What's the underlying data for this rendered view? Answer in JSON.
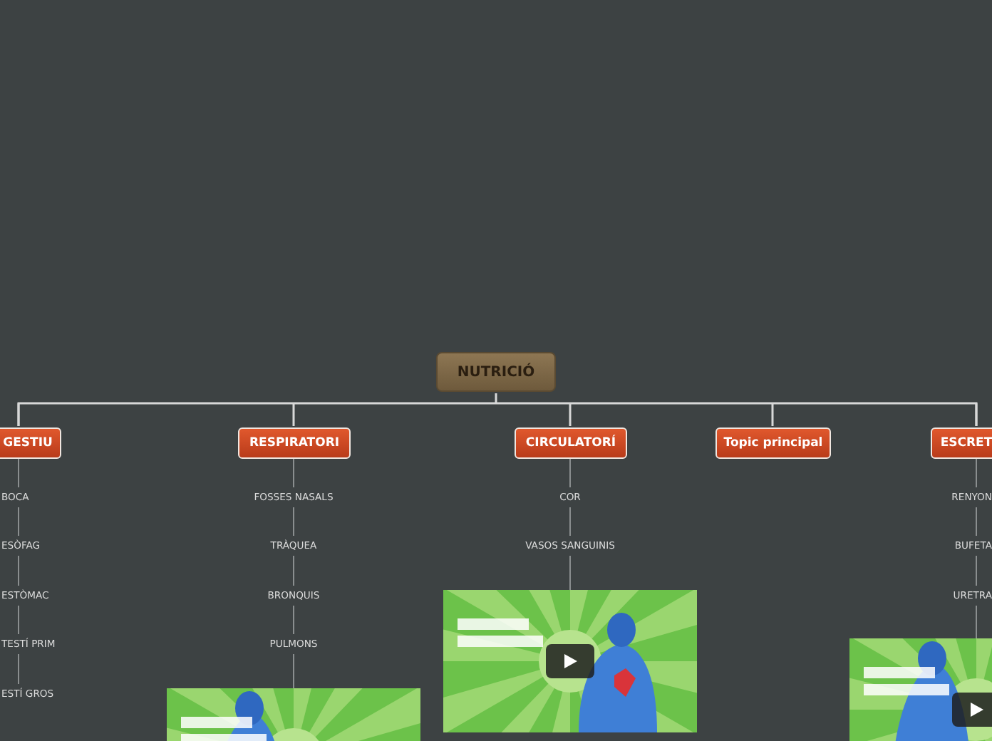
{
  "central": {
    "label": "NUTRICIÓ"
  },
  "topics": [
    {
      "label": "GESTIU",
      "subtopics": [
        "BOCA",
        "ESÒFAG",
        "ESTÒMAC",
        "TESTÍ PRIM",
        "ESTÍ GROS"
      ]
    },
    {
      "label": "RESPIRATORI",
      "subtopics": [
        "FOSSES NASALS",
        "TRÀQUEA",
        "BRONQUIS",
        "PULMONS"
      ],
      "video": {
        "kind": "picture"
      }
    },
    {
      "label": "CIRCULATORÍ",
      "subtopics": [
        "COR",
        "VASOS SANGUINIS"
      ],
      "video": {
        "kind": "picture"
      }
    },
    {
      "label": "Topic principal"
    },
    {
      "label": "ESCRET",
      "subtopics": [
        "RENYON",
        "BUFETA",
        "URETRA"
      ],
      "video": {
        "kind": "picture"
      }
    }
  ]
}
